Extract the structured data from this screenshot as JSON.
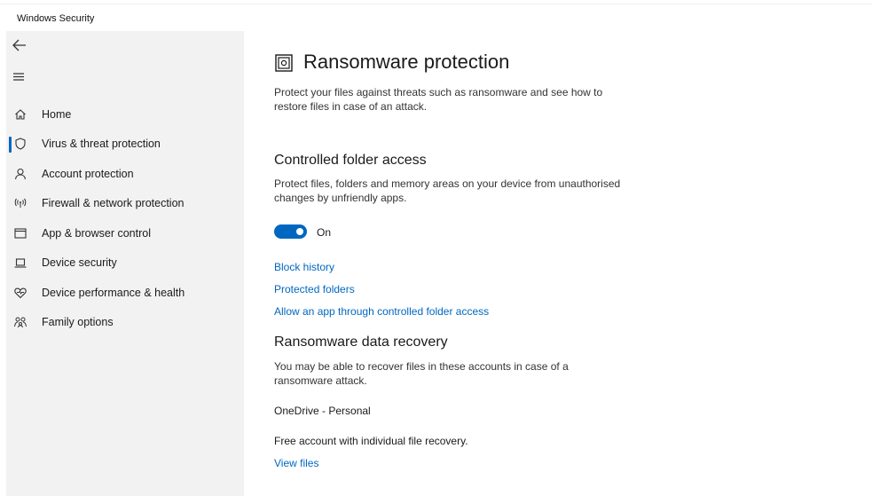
{
  "window": {
    "title": "Windows Security"
  },
  "sidebar": {
    "back_icon": "back-arrow-icon",
    "menu_icon": "hamburger-icon",
    "items": [
      {
        "label": "Home",
        "icon": "home-icon",
        "selected": false
      },
      {
        "label": "Virus & threat protection",
        "icon": "shield-icon",
        "selected": true
      },
      {
        "label": "Account protection",
        "icon": "person-icon",
        "selected": false
      },
      {
        "label": "Firewall & network protection",
        "icon": "wireless-icon",
        "selected": false
      },
      {
        "label": "App & browser control",
        "icon": "browser-window-icon",
        "selected": false
      },
      {
        "label": "Device security",
        "icon": "laptop-icon",
        "selected": false
      },
      {
        "label": "Device performance & health",
        "icon": "heart-pulse-icon",
        "selected": false
      },
      {
        "label": "Family options",
        "icon": "family-icon",
        "selected": false
      }
    ]
  },
  "main": {
    "title": "Ransomware protection",
    "title_icon": "ransomware-icon",
    "description": "Protect your files against threats such as ransomware and see how to restore files in case of an attack.",
    "cfa": {
      "heading": "Controlled folder access",
      "description": "Protect files, folders and memory areas on your device from unauthorised changes by unfriendly apps.",
      "toggle_state": true,
      "toggle_label": "On",
      "links": [
        "Block history",
        "Protected folders",
        "Allow an app through controlled folder access"
      ]
    },
    "recovery": {
      "heading": "Ransomware data recovery",
      "description": "You may be able to recover files in these accounts in case of a ransomware attack.",
      "account": "OneDrive - Personal",
      "account_detail": "Free account with individual file recovery.",
      "view_link": "View files"
    }
  },
  "colors": {
    "accent": "#0067c0",
    "sidebar_bg": "#f2f2f2"
  }
}
